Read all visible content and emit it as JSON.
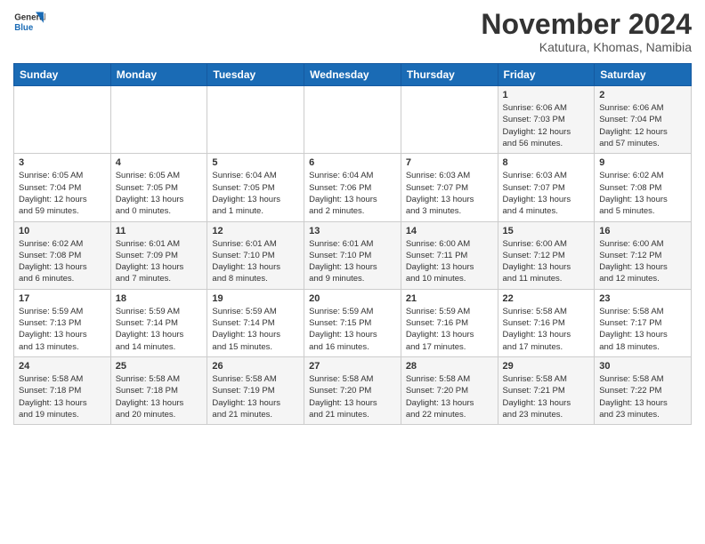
{
  "logo": {
    "line1": "General",
    "line2": "Blue"
  },
  "header": {
    "month": "November 2024",
    "location": "Katutura, Khomas, Namibia"
  },
  "weekdays": [
    "Sunday",
    "Monday",
    "Tuesday",
    "Wednesday",
    "Thursday",
    "Friday",
    "Saturday"
  ],
  "weeks": [
    [
      {
        "day": "",
        "info": ""
      },
      {
        "day": "",
        "info": ""
      },
      {
        "day": "",
        "info": ""
      },
      {
        "day": "",
        "info": ""
      },
      {
        "day": "",
        "info": ""
      },
      {
        "day": "1",
        "info": "Sunrise: 6:06 AM\nSunset: 7:03 PM\nDaylight: 12 hours\nand 56 minutes."
      },
      {
        "day": "2",
        "info": "Sunrise: 6:06 AM\nSunset: 7:04 PM\nDaylight: 12 hours\nand 57 minutes."
      }
    ],
    [
      {
        "day": "3",
        "info": "Sunrise: 6:05 AM\nSunset: 7:04 PM\nDaylight: 12 hours\nand 59 minutes."
      },
      {
        "day": "4",
        "info": "Sunrise: 6:05 AM\nSunset: 7:05 PM\nDaylight: 13 hours\nand 0 minutes."
      },
      {
        "day": "5",
        "info": "Sunrise: 6:04 AM\nSunset: 7:05 PM\nDaylight: 13 hours\nand 1 minute."
      },
      {
        "day": "6",
        "info": "Sunrise: 6:04 AM\nSunset: 7:06 PM\nDaylight: 13 hours\nand 2 minutes."
      },
      {
        "day": "7",
        "info": "Sunrise: 6:03 AM\nSunset: 7:07 PM\nDaylight: 13 hours\nand 3 minutes."
      },
      {
        "day": "8",
        "info": "Sunrise: 6:03 AM\nSunset: 7:07 PM\nDaylight: 13 hours\nand 4 minutes."
      },
      {
        "day": "9",
        "info": "Sunrise: 6:02 AM\nSunset: 7:08 PM\nDaylight: 13 hours\nand 5 minutes."
      }
    ],
    [
      {
        "day": "10",
        "info": "Sunrise: 6:02 AM\nSunset: 7:08 PM\nDaylight: 13 hours\nand 6 minutes."
      },
      {
        "day": "11",
        "info": "Sunrise: 6:01 AM\nSunset: 7:09 PM\nDaylight: 13 hours\nand 7 minutes."
      },
      {
        "day": "12",
        "info": "Sunrise: 6:01 AM\nSunset: 7:10 PM\nDaylight: 13 hours\nand 8 minutes."
      },
      {
        "day": "13",
        "info": "Sunrise: 6:01 AM\nSunset: 7:10 PM\nDaylight: 13 hours\nand 9 minutes."
      },
      {
        "day": "14",
        "info": "Sunrise: 6:00 AM\nSunset: 7:11 PM\nDaylight: 13 hours\nand 10 minutes."
      },
      {
        "day": "15",
        "info": "Sunrise: 6:00 AM\nSunset: 7:12 PM\nDaylight: 13 hours\nand 11 minutes."
      },
      {
        "day": "16",
        "info": "Sunrise: 6:00 AM\nSunset: 7:12 PM\nDaylight: 13 hours\nand 12 minutes."
      }
    ],
    [
      {
        "day": "17",
        "info": "Sunrise: 5:59 AM\nSunset: 7:13 PM\nDaylight: 13 hours\nand 13 minutes."
      },
      {
        "day": "18",
        "info": "Sunrise: 5:59 AM\nSunset: 7:14 PM\nDaylight: 13 hours\nand 14 minutes."
      },
      {
        "day": "19",
        "info": "Sunrise: 5:59 AM\nSunset: 7:14 PM\nDaylight: 13 hours\nand 15 minutes."
      },
      {
        "day": "20",
        "info": "Sunrise: 5:59 AM\nSunset: 7:15 PM\nDaylight: 13 hours\nand 16 minutes."
      },
      {
        "day": "21",
        "info": "Sunrise: 5:59 AM\nSunset: 7:16 PM\nDaylight: 13 hours\nand 17 minutes."
      },
      {
        "day": "22",
        "info": "Sunrise: 5:58 AM\nSunset: 7:16 PM\nDaylight: 13 hours\nand 17 minutes."
      },
      {
        "day": "23",
        "info": "Sunrise: 5:58 AM\nSunset: 7:17 PM\nDaylight: 13 hours\nand 18 minutes."
      }
    ],
    [
      {
        "day": "24",
        "info": "Sunrise: 5:58 AM\nSunset: 7:18 PM\nDaylight: 13 hours\nand 19 minutes."
      },
      {
        "day": "25",
        "info": "Sunrise: 5:58 AM\nSunset: 7:18 PM\nDaylight: 13 hours\nand 20 minutes."
      },
      {
        "day": "26",
        "info": "Sunrise: 5:58 AM\nSunset: 7:19 PM\nDaylight: 13 hours\nand 21 minutes."
      },
      {
        "day": "27",
        "info": "Sunrise: 5:58 AM\nSunset: 7:20 PM\nDaylight: 13 hours\nand 21 minutes."
      },
      {
        "day": "28",
        "info": "Sunrise: 5:58 AM\nSunset: 7:20 PM\nDaylight: 13 hours\nand 22 minutes."
      },
      {
        "day": "29",
        "info": "Sunrise: 5:58 AM\nSunset: 7:21 PM\nDaylight: 13 hours\nand 23 minutes."
      },
      {
        "day": "30",
        "info": "Sunrise: 5:58 AM\nSunset: 7:22 PM\nDaylight: 13 hours\nand 23 minutes."
      }
    ]
  ]
}
